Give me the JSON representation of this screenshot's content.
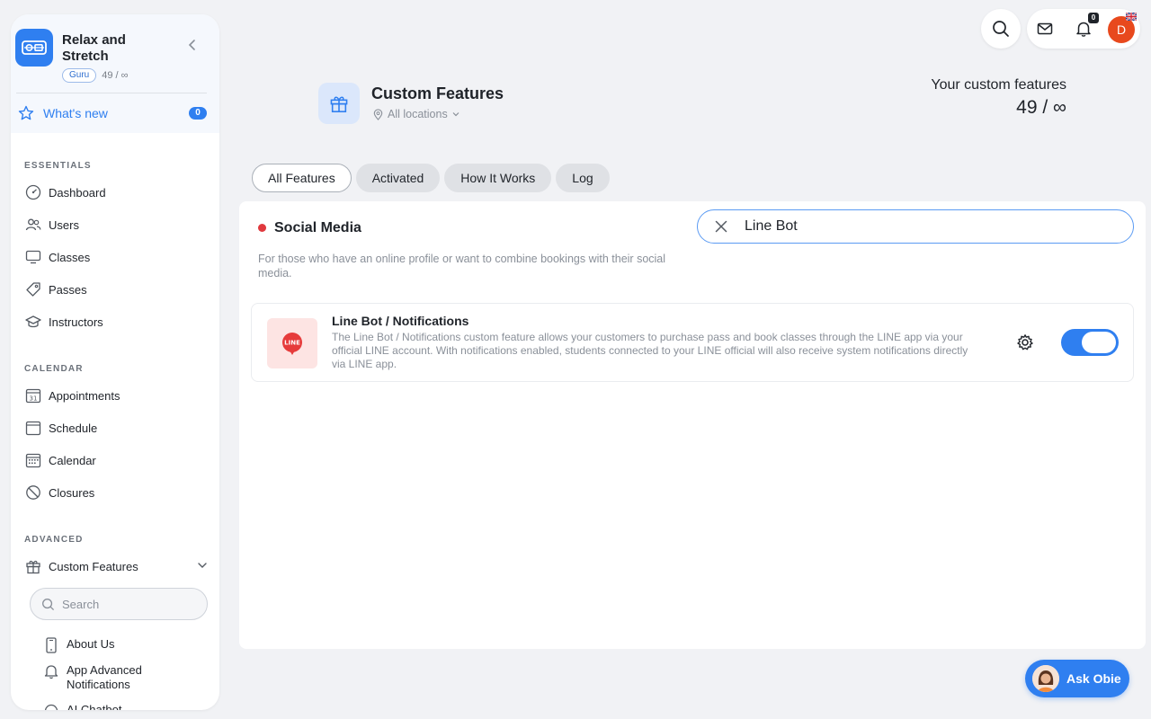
{
  "sidebar": {
    "brand_name": "Relax and Stretch",
    "plan": "Guru",
    "credits": "49 / ∞",
    "whats_new_label": "What's new",
    "whats_new_count": "0",
    "sections": {
      "essentials": "ESSENTIALS",
      "calendar": "CALENDAR",
      "advanced": "ADVANCED"
    },
    "essentials_items": [
      "Dashboard",
      "Users",
      "Classes",
      "Passes",
      "Instructors"
    ],
    "calendar_items": [
      "Appointments",
      "Schedule",
      "Calendar",
      "Closures"
    ],
    "advanced_items": [
      "Custom Features"
    ],
    "search_placeholder": "Search",
    "sub_items": [
      "About Us",
      "App Advanced Notifications",
      "AI Chatbot"
    ]
  },
  "header": {
    "title": "Custom Features",
    "location": "All locations",
    "your_label": "Your custom features",
    "your_value": "49 / ∞"
  },
  "topbar": {
    "bell_count": "0",
    "avatar_initial": "D"
  },
  "tabs": [
    "All Features",
    "Activated",
    "How It Works",
    "Log"
  ],
  "category": {
    "title": "Social Media",
    "description": "For those who have an online profile or want to combine bookings with their social media."
  },
  "filter": {
    "value": "Line Bot"
  },
  "feature": {
    "icon_text": "LINE",
    "title": "Line Bot / Notifications",
    "description": "The Line Bot / Notifications custom feature allows your customers to purchase pass and book classes through the LINE app via your official LINE account. With notifications enabled, students connected to your LINE official will also receive system notifications directly via LINE app.",
    "enabled": true
  },
  "ask_obie": {
    "label": "Ask Obie"
  },
  "colors": {
    "accent": "#2f7ff0",
    "category_dot": "#e0393e",
    "avatar": "#e8491d"
  }
}
